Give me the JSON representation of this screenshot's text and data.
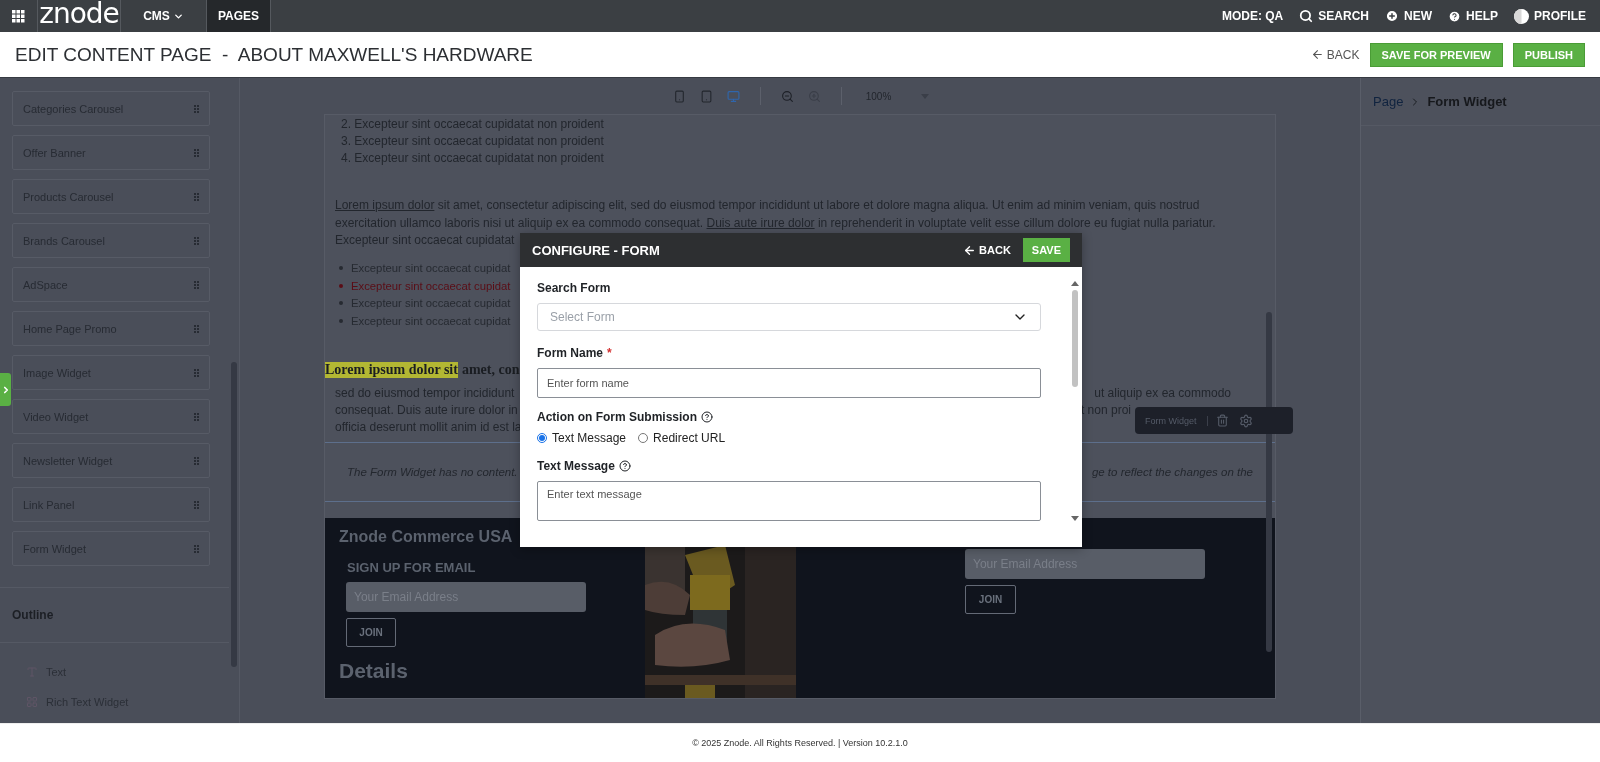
{
  "top_nav": {
    "logo": "znode",
    "items": [
      {
        "label": "CMS",
        "kind": "dropdown",
        "selected": false
      },
      {
        "label": "PAGES",
        "kind": "plain",
        "selected": true
      }
    ],
    "mode": "MODE: QA",
    "actions": [
      {
        "label": "SEARCH",
        "kind": "search"
      },
      {
        "label": "NEW",
        "kind": "new"
      },
      {
        "label": "HELP",
        "kind": "help"
      },
      {
        "label": "PROFILE",
        "kind": "profile"
      }
    ]
  },
  "header": {
    "title": "EDIT CONTENT PAGE  -  ABOUT MAXWELL'S HARDWARE",
    "back": "BACK",
    "buttons": [
      "SAVE FOR PREVIEW",
      "PUBLISH"
    ]
  },
  "widgets": [
    "Categories Carousel",
    "Offer Banner",
    "Products Carousel",
    "Brands Carousel",
    "AdSpace",
    "Home Page Promo",
    "Image Widget",
    "Video Widget",
    "Newsletter Widget",
    "Link Panel",
    "Form Widget"
  ],
  "outline": {
    "title": "Outline",
    "items": [
      {
        "label": "Text",
        "kind": "text"
      },
      {
        "label": "Rich Text Widget",
        "kind": "grid"
      }
    ]
  },
  "canvas_toolbar": {
    "devices": [
      {
        "kind": "mobile",
        "selected": false
      },
      {
        "kind": "tablet",
        "selected": false
      },
      {
        "kind": "desktop",
        "selected": true
      }
    ],
    "zoom": [
      {
        "kind": "out",
        "disabled": false
      },
      {
        "kind": "in",
        "disabled": true
      }
    ],
    "zoom_value": "100%"
  },
  "content": {
    "numbered": [
      {
        "number": "2.",
        "text": "Excepteur sint occaecat cupidatat non proident"
      },
      {
        "number": "3.",
        "text": "Excepteur sint occaecat cupidatat non proident"
      },
      {
        "number": "4.",
        "text": "Excepteur sint occaecat cupidatat non proident"
      }
    ],
    "paragraph": [
      [
        {
          "kind": "link",
          "text": "Lorem ipsum dolor"
        },
        {
          "kind": "plain",
          "text": " sit amet, consectetur adipiscing elit, sed do eiusmod tempor incididunt ut labore et dolore magna aliqua. Ut enim ad minim veniam, quis nostrud"
        }
      ],
      [
        {
          "kind": "plain",
          "text": "exercitation ullamco laboris nisi ut aliquip ex ea commodo consequat. "
        },
        {
          "kind": "link",
          "text": "Duis aute irure dolor"
        },
        {
          "kind": "plain",
          "text": " in reprehenderit in voluptate velit esse cillum dolore eu fugiat nulla pariatur."
        }
      ],
      [
        {
          "kind": "plain",
          "text": "Excepteur sint occaecat cupidatat"
        }
      ]
    ],
    "bullets": [
      {
        "text": "Excepteur sint occaecat cupidat",
        "color": "#262a31"
      },
      {
        "text": "Excepteur sint occaecat cupidat",
        "color": "#5a0d16"
      },
      {
        "text": "Excepteur sint occaecat cupidat",
        "color": "#262a31"
      },
      {
        "text": "Excepteur sint occaecat cupidat",
        "color": "#262a31"
      }
    ],
    "heading": {
      "highlighted": "Lorem ipsum dolor sit",
      "rest": "amet, con"
    },
    "body_lines": [
      {
        "left": "sed do eiusmod tempor incididunt",
        "right": "ut aliquip ex ea commodo"
      },
      {
        "left": "consequat. Duis aute irure dolor in",
        "right": "t non proi"
      },
      {
        "left": "officia deserunt mollit anim id est la"
      }
    ],
    "widget_toolbar": {
      "label": "Form Widget"
    },
    "form_placeholder": {
      "left": "The Form Widget has no content.",
      "right": "ge to reflect the changes on the"
    },
    "newsletter": {
      "brand": "Znode Commerce USA",
      "signup": "SIGN UP FOR EMAIL",
      "email_placeholder": "Your Email Address",
      "join": "JOIN",
      "details": "Details",
      "right_email_placeholder": "Your Email Address",
      "right_join": "JOIN"
    }
  },
  "breadcrumb": {
    "parent": "Page",
    "current": "Form Widget"
  },
  "modal": {
    "title": "CONFIGURE - FORM",
    "back": "BACK",
    "save": "SAVE",
    "search_label": "Search Form",
    "search_placeholder": "Select Form",
    "name_label": "Form Name",
    "name_required": "*",
    "name_placeholder": "Enter form name",
    "action_label": "Action on Form Submission",
    "options": [
      {
        "label": "Text Message",
        "selected": true
      },
      {
        "label": "Redirect URL",
        "selected": false
      }
    ],
    "message_label": "Text Message",
    "message_placeholder": "Enter text message"
  },
  "footer": "© 2025 Znode. All Rights Reserved. | Version 10.2.1.0"
}
